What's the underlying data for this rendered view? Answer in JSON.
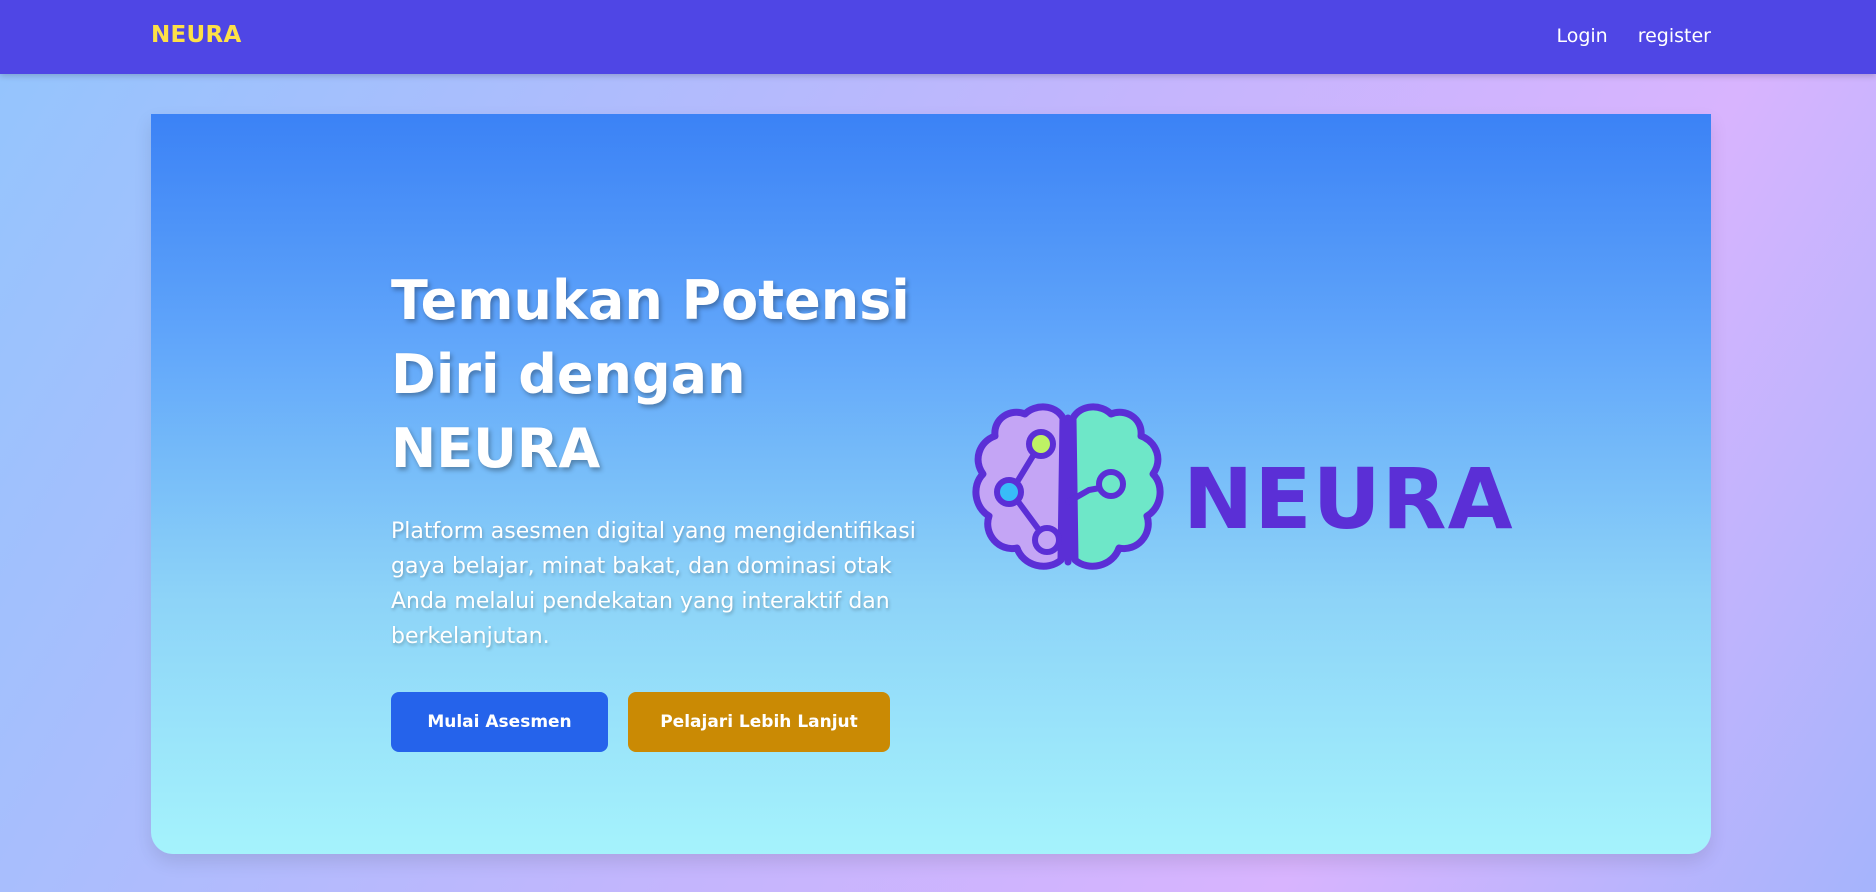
{
  "navbar": {
    "brand": "NEURA",
    "links": [
      {
        "label": "Login"
      },
      {
        "label": "register"
      }
    ]
  },
  "hero": {
    "title_lines": [
      "Temukan Potensi",
      "Diri dengan",
      "NEURA"
    ],
    "description": "Platform asesmen digital yang mengidentifikasi gaya belajar, minat bakat, dan dominasi otak Anda melalui pendekatan yang interaktif dan berkelanjutan.",
    "primary_button": "Mulai Asesmen",
    "secondary_button": "Pelajari Lebih Lanjut",
    "logo_text": "NEURA"
  },
  "colors": {
    "navbar_bg": "#4f46e5",
    "brand": "#fde047",
    "primary_button": "#2563eb",
    "secondary_button": "#ca8a04",
    "logo_purple": "#5b2fd6",
    "brain_left": "#c4a5f5",
    "brain_right": "#6ee7c8"
  },
  "icons": {
    "logo": "brain-icon"
  }
}
